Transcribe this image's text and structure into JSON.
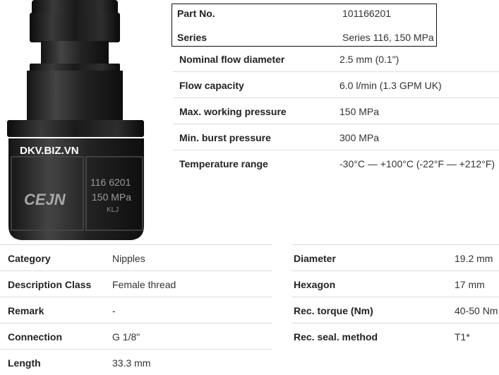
{
  "product_image": {
    "watermark": "DKV.BIZ.VN",
    "brand_logo": "CEJN",
    "engraving_line1": "116 6201",
    "engraving_line2": "150 MPa",
    "engraving_line3": "KLJ"
  },
  "part_info": {
    "part_no_label": "Part No.",
    "part_no_value": "101166201",
    "series_label": "Series",
    "series_value": "Series 116, 150 MPa"
  },
  "specs": [
    {
      "label": "Nominal flow diameter",
      "value": "2.5 mm (0.1\")"
    },
    {
      "label": "Flow capacity",
      "value": "6.0 l/min (1.3 GPM UK)"
    },
    {
      "label": "Max. working pressure",
      "value": "150 MPa"
    },
    {
      "label": "Min. burst pressure",
      "value": "300 MPa"
    },
    {
      "label": "Temperature range",
      "value": "-30°C — +100°C (-22°F — +212°F)"
    }
  ],
  "details_left": [
    {
      "label": "Category",
      "value": "Nipples"
    },
    {
      "label": "Description Class",
      "value": "Female thread"
    },
    {
      "label": "Remark",
      "value": "-"
    },
    {
      "label": "Connection",
      "value": "G 1/8\""
    },
    {
      "label": "Length",
      "value": "33.3 mm"
    }
  ],
  "details_right": [
    {
      "label": "Diameter",
      "value": "19.2 mm"
    },
    {
      "label": "Hexagon",
      "value": "17 mm"
    },
    {
      "label": "Rec. torque (Nm)",
      "value": "40-50 Nm"
    },
    {
      "label": "Rec. seal. method",
      "value": "T1*"
    }
  ],
  "colors": {
    "border": "#dcdcdc",
    "part_box_border": "#111111",
    "product_body": "#1c1c1c"
  }
}
